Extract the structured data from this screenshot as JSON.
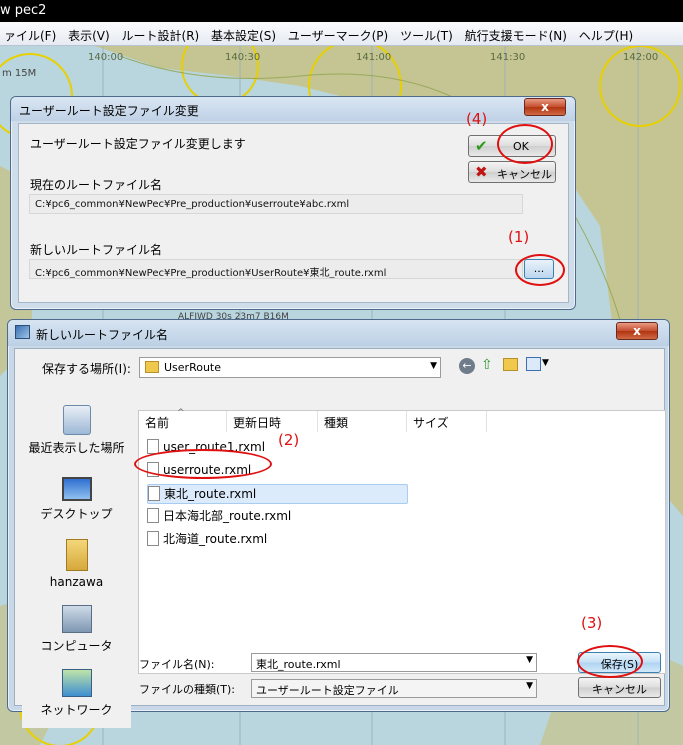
{
  "app": {
    "title_fragment": "w pec2"
  },
  "menu": [
    "ァイル(F)",
    "表示(V)",
    "ルート設計(R)",
    "基本設定(S)",
    "ユーザーマーク(P)",
    "ツール(T)",
    "航行支援モード(N)",
    "ヘルプ(H)"
  ],
  "chart": {
    "longitudes": [
      "140:00",
      "140:30",
      "141:00",
      "141:30",
      "142:00"
    ],
    "depth_label": "m 15M",
    "note": "ALFIWD 30s 23m7 B16M"
  },
  "change_dialog": {
    "title": "ユーザールート設定ファイル変更",
    "close_label": "x",
    "message": "ユーザールート設定ファイル変更します",
    "current_label": "現在のルートファイル名",
    "current_path": "C:¥pc6_common¥NewPec¥Pre_production¥userroute¥abc.rxml",
    "new_label": "新しいルートファイル名",
    "new_path": "C:¥pc6_common¥NewPec¥Pre_production¥UserRoute¥東北_route.rxml",
    "ok_label": "OK",
    "cancel_label": "キャンセル",
    "browse_label": "..."
  },
  "save_dialog": {
    "title": "新しいルートファイル名",
    "close_label": "x",
    "location_label": "保存する場所(I):",
    "location_value": "UserRoute",
    "columns": [
      "名前",
      "更新日時",
      "種類",
      "サイズ"
    ],
    "files": [
      "user_route1.rxml",
      "userroute.rxml",
      "東北_route.rxml",
      "日本海北部_route.rxml",
      "北海道_route.rxml"
    ],
    "selected_file": "東北_route.rxml",
    "places": [
      "最近表示した場所",
      "デスクトップ",
      "hanzawa",
      "コンピュータ",
      "ネットワーク"
    ],
    "filename_label": "ファイル名(N):",
    "filename_value": "東北_route.rxml",
    "filetype_label": "ファイルの種類(T):",
    "filetype_value": "ユーザールート設定ファイル",
    "save_label": "保存(S)",
    "cancel_label": "キャンセル"
  },
  "annotations": [
    "(1)",
    "(2)",
    "(3)",
    "(4)"
  ],
  "colors": {
    "annotation": "#e01010",
    "titlebar": "#000000",
    "chart_land": "#c8bf7a",
    "chart_sea": "#b9d6df",
    "range_ring": "#e8d000"
  }
}
